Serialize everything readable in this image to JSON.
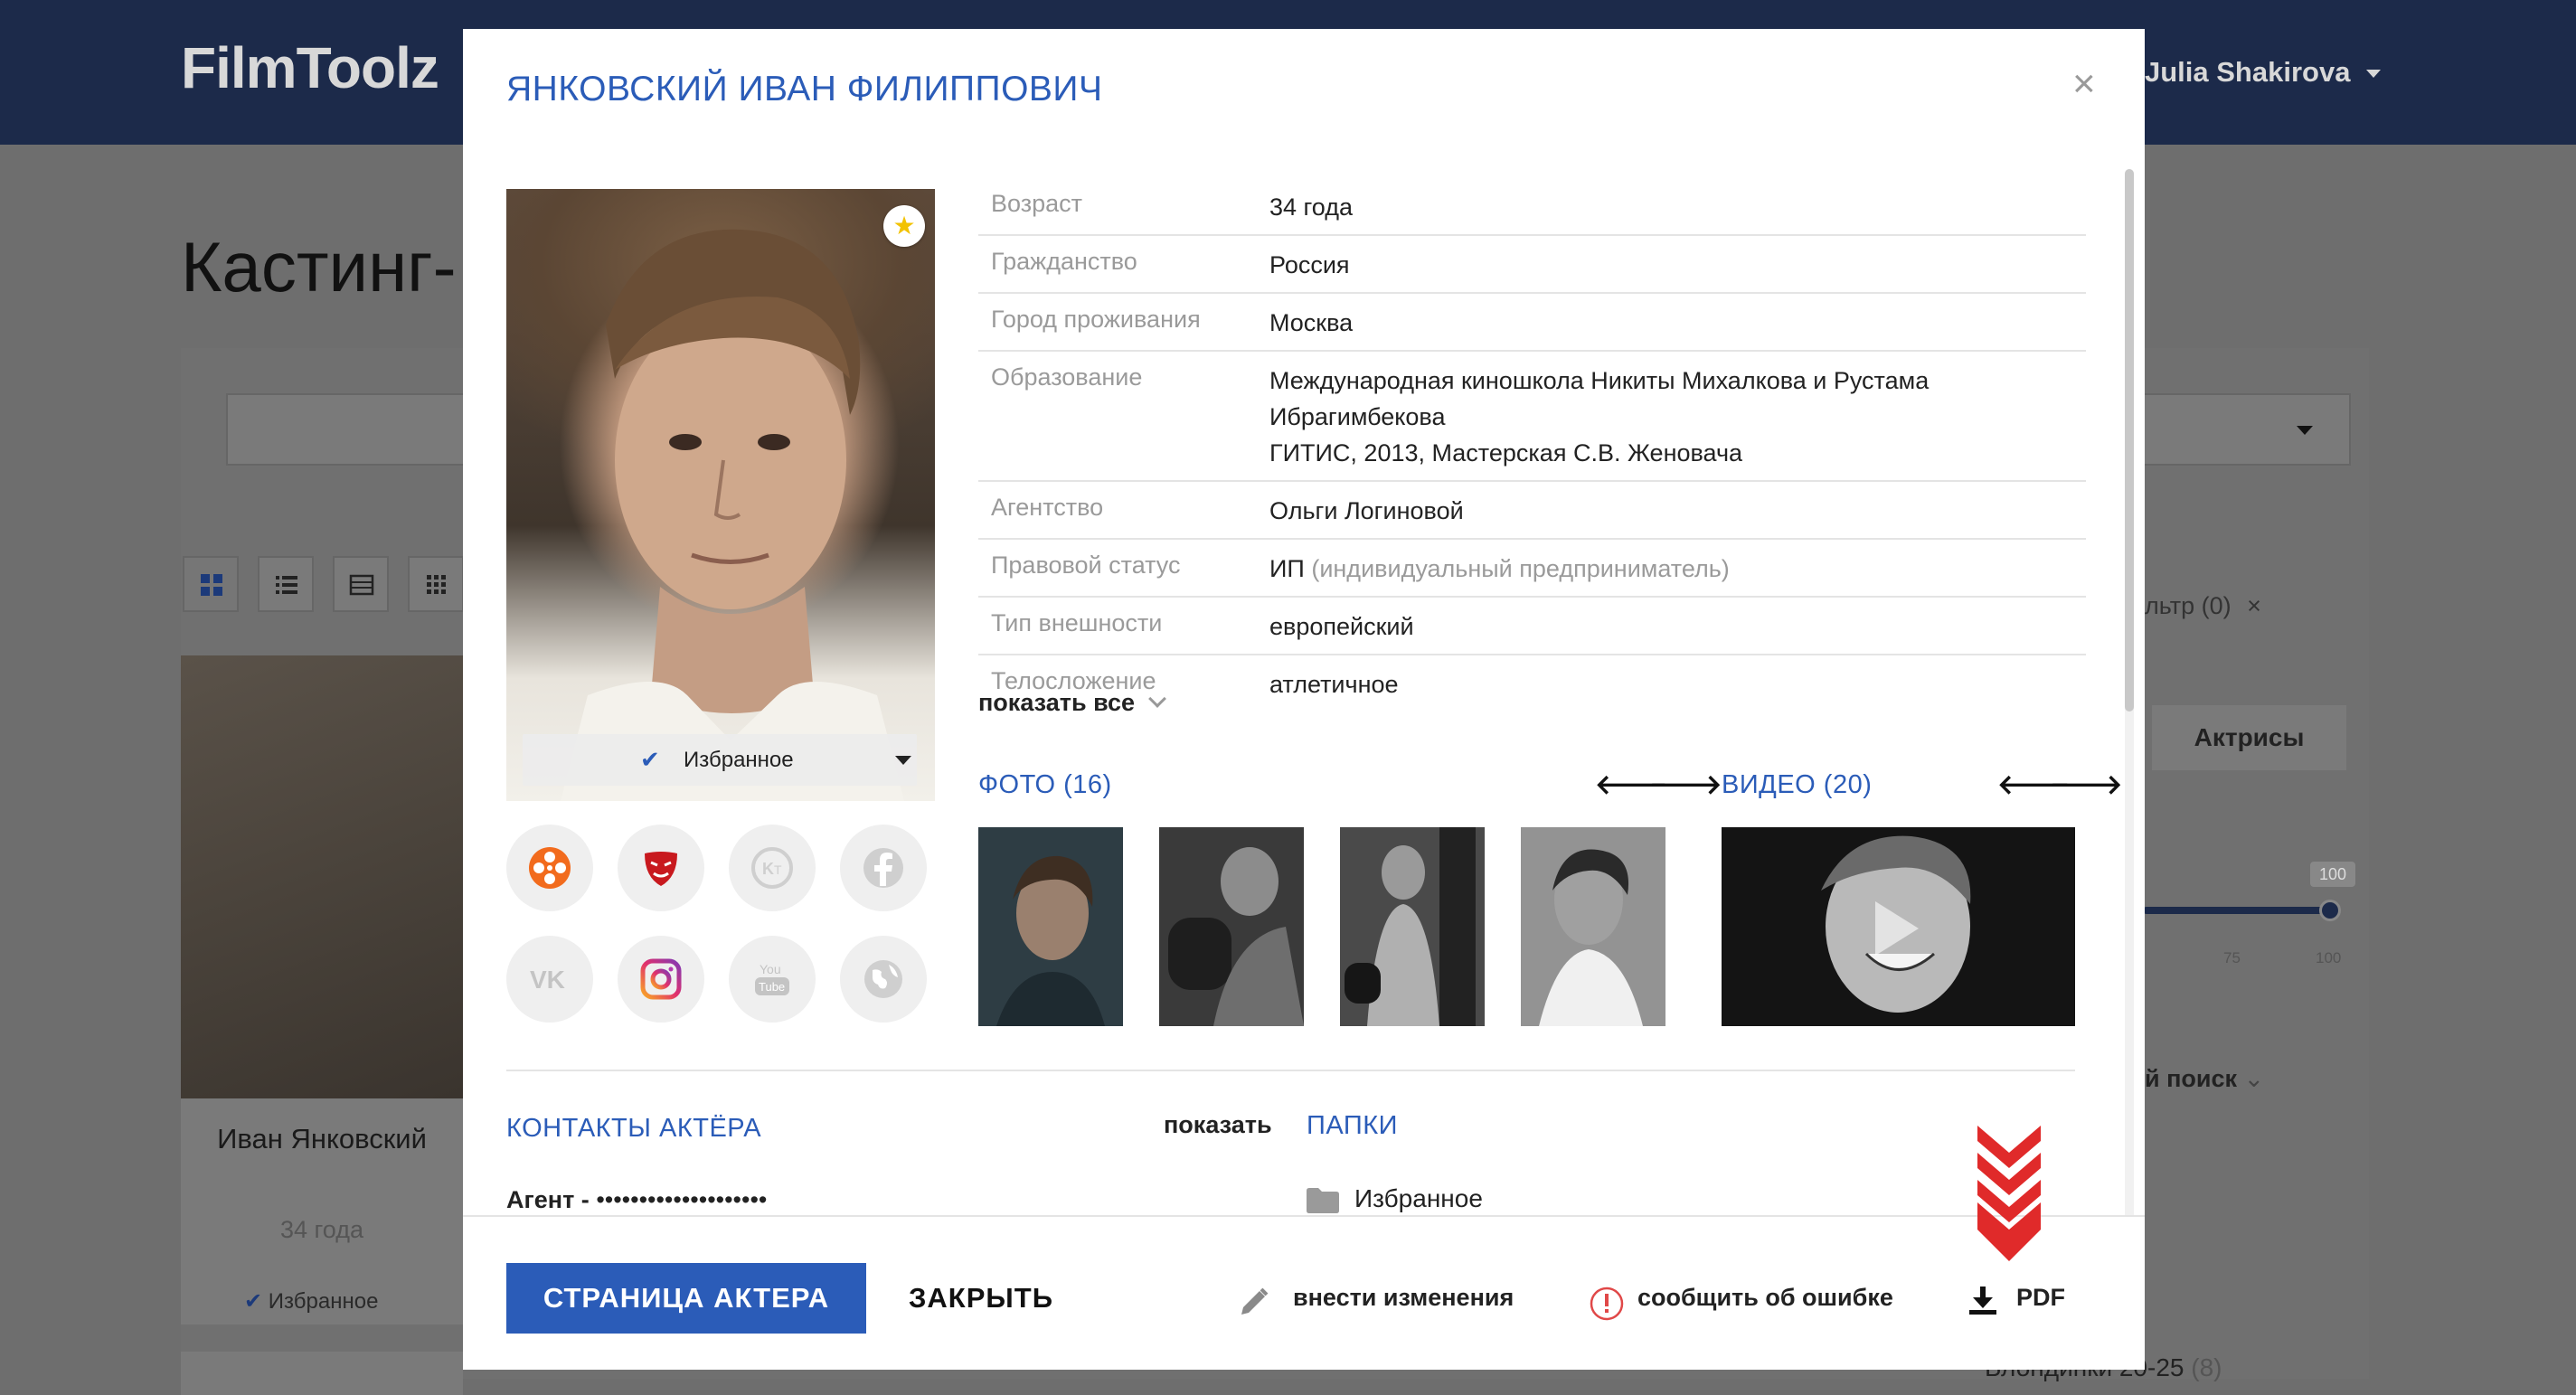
{
  "background": {
    "logo": "FilmToolz",
    "user_name": "Julia Shakirova",
    "page_title_fragment": "Кастинг-",
    "card": {
      "name": "Иван Янковский",
      "age": "34 года",
      "favorite": "Избранное"
    },
    "filter_text": "льтр (0)",
    "tab_actresses": "Актрисы",
    "slider_value": "100",
    "slider_ticks": [
      "75",
      "100"
    ],
    "search_text": "й поиск",
    "list_item": "Блондинки 20-25",
    "list_item_count": "(8)"
  },
  "modal": {
    "title": "ЯНКОВСКИЙ ИВАН ФИЛИППОВИЧ",
    "close_symbol": "×",
    "favorite_label": "Избранное",
    "info": [
      {
        "label": "Возраст",
        "value": "34 года"
      },
      {
        "label": "Гражданство",
        "value": "Россия"
      },
      {
        "label": "Город проживания",
        "value": "Москва"
      },
      {
        "label": "Образование",
        "value_lines": [
          "Международная киношкола Никиты Михалкова и Рустама",
          "Ибрагимбекова",
          "ГИТИС, 2013, Мастерская С.В. Женовача"
        ]
      },
      {
        "label": "Агентство",
        "value": "Ольги Логиновой"
      },
      {
        "label": "Правовой статус",
        "value": "ИП",
        "value_muted": "(индивидуальный предприниматель)"
      },
      {
        "label": "Тип внешности",
        "value": "европейский"
      },
      {
        "label": "Телосложение",
        "value": "атлетичное"
      }
    ],
    "show_all": "показать все",
    "photos_title": "ФОТО (16)",
    "videos_title": "ВИДЕО (20)",
    "contacts_title": "КОНТАКТЫ АКТЁРА",
    "contacts_show": "показать",
    "agent_label": "Агент -",
    "agent_value": "••••••••••••••••••••",
    "folders_title": "ПАПКИ",
    "folder_name": "Избранное",
    "social_icons": [
      "kinopoisk-icon",
      "theater-mask-icon",
      "kino-teatr-icon",
      "facebook-icon",
      "vk-icon",
      "instagram-icon",
      "youtube-icon",
      "globe-icon"
    ],
    "footer": {
      "actor_page": "СТРАНИЦА АКТЕРА",
      "close": "ЗАКРЫТЬ",
      "edit": "внести изменения",
      "report": "сообщить об ошибке",
      "pdf": "PDF"
    },
    "colors": {
      "accent": "#2b5cb8",
      "chevron": "#e02a2a"
    }
  }
}
